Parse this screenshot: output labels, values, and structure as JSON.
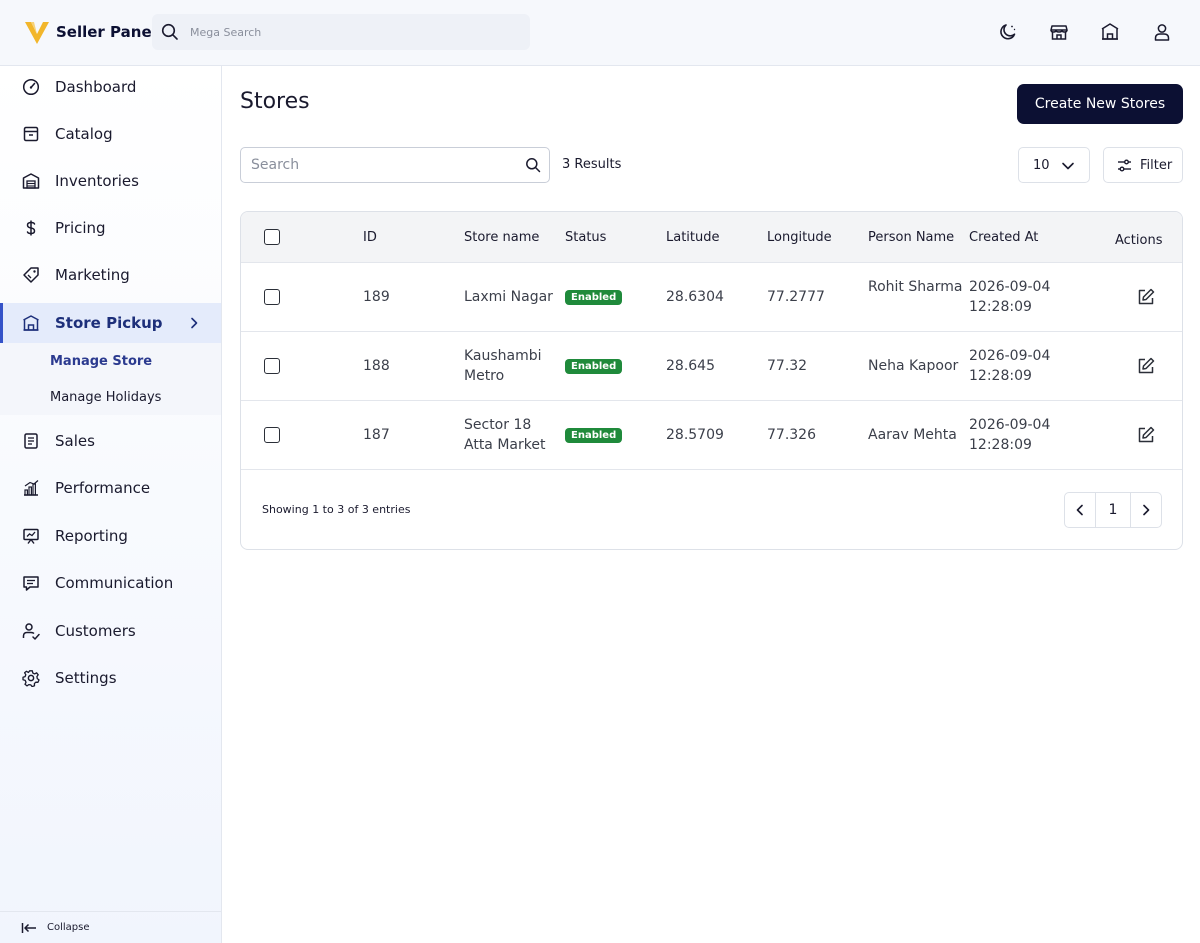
{
  "header": {
    "app_name": "Seller Panel",
    "search_placeholder": "Mega Search",
    "icons": [
      "moon-icon",
      "storefront-icon",
      "building-icon",
      "user-icon"
    ]
  },
  "sidebar": {
    "items": [
      {
        "label": "Dashboard",
        "icon": "dashboard-icon"
      },
      {
        "label": "Catalog",
        "icon": "catalog-icon"
      },
      {
        "label": "Inventories",
        "icon": "warehouse-icon"
      },
      {
        "label": "Pricing",
        "icon": "dollar-icon"
      },
      {
        "label": "Marketing",
        "icon": "tag-icon"
      },
      {
        "label": "Store Pickup",
        "icon": "store-icon",
        "active": true,
        "subitems": [
          {
            "label": "Manage Store",
            "active": true
          },
          {
            "label": "Manage Holidays"
          }
        ]
      },
      {
        "label": "Sales",
        "icon": "document-icon"
      },
      {
        "label": "Performance",
        "icon": "bar-chart-icon"
      },
      {
        "label": "Reporting",
        "icon": "presentation-icon"
      },
      {
        "label": "Communication",
        "icon": "chat-icon"
      },
      {
        "label": "Customers",
        "icon": "customers-icon"
      },
      {
        "label": "Settings",
        "icon": "gear-icon"
      }
    ],
    "collapse_label": "Collapse"
  },
  "main": {
    "title": "Stores",
    "create_button": "Create New Stores",
    "search_placeholder": "Search",
    "results_text": "3 Results",
    "per_page": "10",
    "filter_label": "Filter",
    "table": {
      "columns": [
        "ID",
        "Store name",
        "Status",
        "Latitude",
        "Longitude",
        "Person Name",
        "Created At",
        "Actions"
      ],
      "rows": [
        {
          "id": "189",
          "store_name": "Laxmi Nagar",
          "status": "Enabled",
          "latitude": "28.6304",
          "longitude": "77.2777",
          "person": "Rohit Sharma",
          "created_date": "2026-09-04",
          "created_time": "12:28:09"
        },
        {
          "id": "188",
          "store_name": "Kaushambi Metro",
          "status": "Enabled",
          "latitude": "28.645",
          "longitude": "77.32",
          "person": "Neha Kapoor",
          "created_date": "2026-09-04",
          "created_time": "12:28:09"
        },
        {
          "id": "187",
          "store_name": "Sector 18 Atta Market",
          "status": "Enabled",
          "latitude": "28.5709",
          "longitude": "77.326",
          "person": "Aarav Mehta",
          "created_date": "2026-09-04",
          "created_time": "12:28:09"
        }
      ]
    },
    "showing_text": "Showing 1 to 3 of 3 entries",
    "current_page": "1"
  },
  "colors": {
    "primary_dark": "#0c1033",
    "active_nav_bg": "#e4ebfb",
    "active_nav_border": "#3452c8",
    "enabled_badge": "#1f8a3b",
    "logo_gold": "#f2b62b"
  }
}
